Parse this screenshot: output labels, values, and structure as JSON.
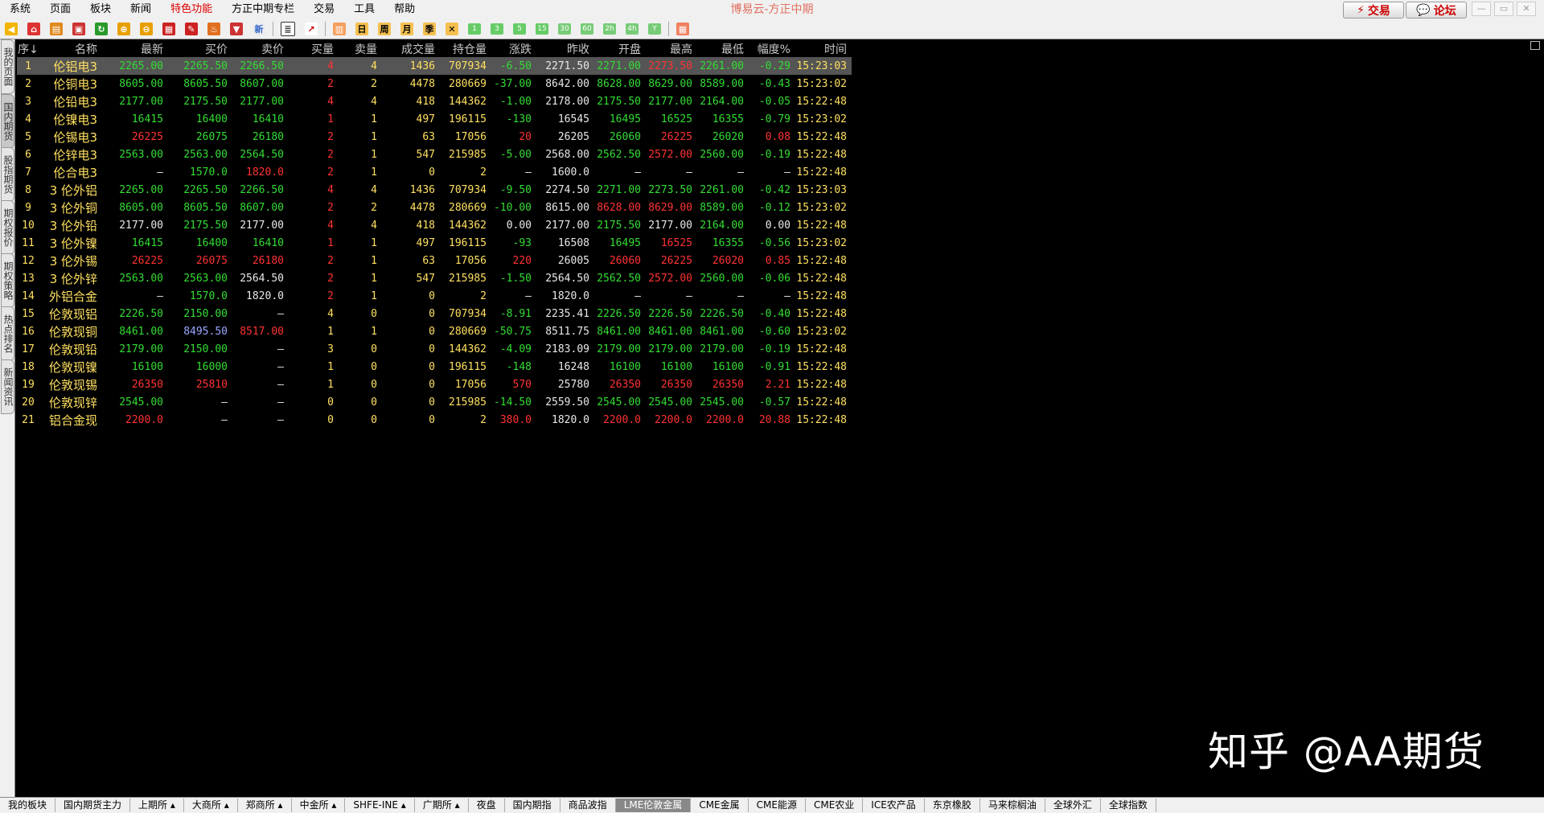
{
  "app_title": "博易云-方正中期",
  "menu": [
    "系统",
    "页面",
    "板块",
    "新闻",
    "特色功能",
    "方正中期专栏",
    "交易",
    "工具",
    "帮助"
  ],
  "menu_highlight_index": 4,
  "top_buttons": {
    "trade": "交易",
    "forum": "论坛"
  },
  "toolbar_labels": {
    "new": "新",
    "day": "日",
    "week": "周",
    "month": "月",
    "season": "季",
    "year": "Y"
  },
  "toolbar_pills": [
    "1",
    "3",
    "5",
    "15",
    "30",
    "60",
    "2h",
    "4h"
  ],
  "side_tabs": [
    "我的页面",
    "国内期货",
    "股指期货",
    "期权报价",
    "期权策略",
    "热点排名",
    "新闻资讯"
  ],
  "columns": [
    "序↓",
    "名称",
    "最新",
    "买价",
    "卖价",
    "买量",
    "卖量",
    "成交量",
    "持仓量",
    "涨跌",
    "昨收",
    "开盘",
    "最高",
    "最低",
    "幅度%",
    "时间"
  ],
  "rows": [
    [
      "1",
      "伦铝电3",
      "2265.00",
      "2265.50",
      "2266.50",
      "4",
      "4",
      "1436",
      "707934",
      "-6.50",
      "2271.50",
      "2271.00",
      "2273.50",
      "2261.00",
      "-0.29",
      "15:23:03"
    ],
    [
      "2",
      "伦铜电3",
      "8605.00",
      "8605.50",
      "8607.00",
      "2",
      "2",
      "4478",
      "280669",
      "-37.00",
      "8642.00",
      "8628.00",
      "8629.00",
      "8589.00",
      "-0.43",
      "15:23:02"
    ],
    [
      "3",
      "伦铅电3",
      "2177.00",
      "2175.50",
      "2177.00",
      "4",
      "4",
      "418",
      "144362",
      "-1.00",
      "2178.00",
      "2175.50",
      "2177.00",
      "2164.00",
      "-0.05",
      "15:22:48"
    ],
    [
      "4",
      "伦镍电3",
      "16415",
      "16400",
      "16410",
      "1",
      "1",
      "497",
      "196115",
      "-130",
      "16545",
      "16495",
      "16525",
      "16355",
      "-0.79",
      "15:23:02"
    ],
    [
      "5",
      "伦锡电3",
      "26225",
      "26075",
      "26180",
      "2",
      "1",
      "63",
      "17056",
      "20",
      "26205",
      "26060",
      "26225",
      "26020",
      "0.08",
      "15:22:48"
    ],
    [
      "6",
      "伦锌电3",
      "2563.00",
      "2563.00",
      "2564.50",
      "2",
      "1",
      "547",
      "215985",
      "-5.00",
      "2568.00",
      "2562.50",
      "2572.00",
      "2560.00",
      "-0.19",
      "15:22:48"
    ],
    [
      "7",
      "伦合电3",
      "—",
      "1570.0",
      "1820.0",
      "2",
      "1",
      "0",
      "2",
      "—",
      "1600.0",
      "—",
      "—",
      "—",
      "—",
      "15:22:48"
    ],
    [
      "8",
      "3 伦外铝",
      "2265.00",
      "2265.50",
      "2266.50",
      "4",
      "4",
      "1436",
      "707934",
      "-9.50",
      "2274.50",
      "2271.00",
      "2273.50",
      "2261.00",
      "-0.42",
      "15:23:03"
    ],
    [
      "9",
      "3 伦外铜",
      "8605.00",
      "8605.50",
      "8607.00",
      "2",
      "2",
      "4478",
      "280669",
      "-10.00",
      "8615.00",
      "8628.00",
      "8629.00",
      "8589.00",
      "-0.12",
      "15:23:02"
    ],
    [
      "10",
      "3 伦外铅",
      "2177.00",
      "2175.50",
      "2177.00",
      "4",
      "4",
      "418",
      "144362",
      "0.00",
      "2177.00",
      "2175.50",
      "2177.00",
      "2164.00",
      "0.00",
      "15:22:48"
    ],
    [
      "11",
      "3 伦外镍",
      "16415",
      "16400",
      "16410",
      "1",
      "1",
      "497",
      "196115",
      "-93",
      "16508",
      "16495",
      "16525",
      "16355",
      "-0.56",
      "15:23:02"
    ],
    [
      "12",
      "3 伦外锡",
      "26225",
      "26075",
      "26180",
      "2",
      "1",
      "63",
      "17056",
      "220",
      "26005",
      "26060",
      "26225",
      "26020",
      "0.85",
      "15:22:48"
    ],
    [
      "13",
      "3 伦外锌",
      "2563.00",
      "2563.00",
      "2564.50",
      "2",
      "1",
      "547",
      "215985",
      "-1.50",
      "2564.50",
      "2562.50",
      "2572.00",
      "2560.00",
      "-0.06",
      "15:22:48"
    ],
    [
      "14",
      "外铝合金",
      "—",
      "1570.0",
      "1820.0",
      "2",
      "1",
      "0",
      "2",
      "—",
      "1820.0",
      "—",
      "—",
      "—",
      "—",
      "15:22:48"
    ],
    [
      "15",
      "伦敦现铝",
      "2226.50",
      "2150.00",
      "—",
      "4",
      "0",
      "0",
      "707934",
      "-8.91",
      "2235.41",
      "2226.50",
      "2226.50",
      "2226.50",
      "-0.40",
      "15:22:48"
    ],
    [
      "16",
      "伦敦现铜",
      "8461.00",
      "8495.50",
      "8517.00",
      "1",
      "1",
      "0",
      "280669",
      "-50.75",
      "8511.75",
      "8461.00",
      "8461.00",
      "8461.00",
      "-0.60",
      "15:23:02"
    ],
    [
      "17",
      "伦敦现铅",
      "2179.00",
      "2150.00",
      "—",
      "3",
      "0",
      "0",
      "144362",
      "-4.09",
      "2183.09",
      "2179.00",
      "2179.00",
      "2179.00",
      "-0.19",
      "15:22:48"
    ],
    [
      "18",
      "伦敦现镍",
      "16100",
      "16000",
      "—",
      "1",
      "0",
      "0",
      "196115",
      "-148",
      "16248",
      "16100",
      "16100",
      "16100",
      "-0.91",
      "15:22:48"
    ],
    [
      "19",
      "伦敦现锡",
      "26350",
      "25810",
      "—",
      "1",
      "0",
      "0",
      "17056",
      "570",
      "25780",
      "26350",
      "26350",
      "26350",
      "2.21",
      "15:22:48"
    ],
    [
      "20",
      "伦敦现锌",
      "2545.00",
      "—",
      "—",
      "0",
      "0",
      "0",
      "215985",
      "-14.50",
      "2559.50",
      "2545.00",
      "2545.00",
      "2545.00",
      "-0.57",
      "15:22:48"
    ],
    [
      "21",
      "铝合金现",
      "2200.0",
      "—",
      "—",
      "0",
      "0",
      "0",
      "2",
      "380.0",
      "1820.0",
      "2200.0",
      "2200.0",
      "2200.0",
      "20.88",
      "15:22:48"
    ]
  ],
  "watermark": "知乎 @AA期货",
  "bottom_tabs": [
    "我的板块",
    "国内期货主力",
    "上期所 ▴",
    "大商所 ▴",
    "郑商所 ▴",
    "中金所 ▴",
    "SHFE-INE ▴",
    "广期所 ▴",
    "夜盘",
    "国内期指",
    "商品波指",
    "LME伦敦金属",
    "CME金属",
    "CME能源",
    "CME农业",
    "ICE农产品",
    "东京橡胶",
    "马来棕榈油",
    "全球外汇",
    "全球指数"
  ],
  "bottom_active_index": 11,
  "colors": {
    "up": "#ff3333",
    "down": "#33dd33",
    "flat": "#e8e8e8",
    "name": "#ffe060",
    "volume": "#ffe060"
  }
}
